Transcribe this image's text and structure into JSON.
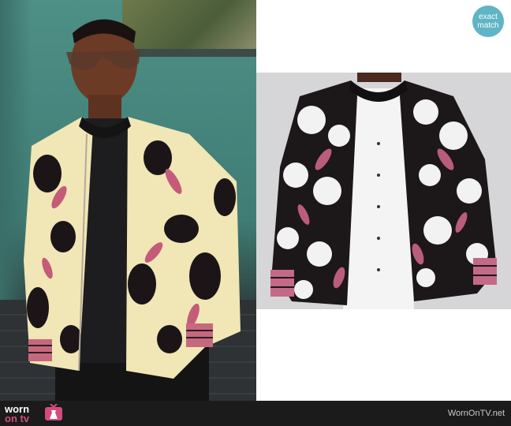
{
  "badge": {
    "line1": "exact",
    "line2": "match"
  },
  "logo": {
    "top": "worn",
    "bottom": "on tv"
  },
  "footer": {
    "site": "WornOnTV.net"
  },
  "colors": {
    "badge_bg": "#5fb4c6",
    "footer_bg": "#1b1b1b",
    "brand_pink": "#d64a7e"
  },
  "images": {
    "left": "tv-show-still-man-in-floral-bomber-jacket",
    "right": "product-photo-floral-bomber-jacket"
  },
  "icons": [
    "tv-dress-icon"
  ]
}
